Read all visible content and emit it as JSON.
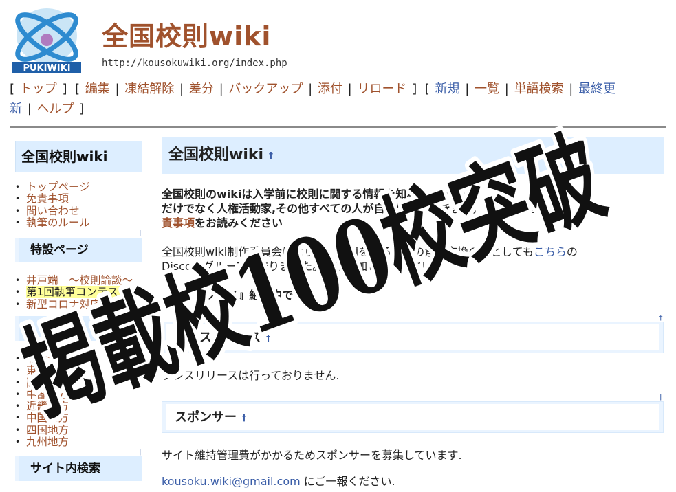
{
  "header": {
    "logo_text": "PUKIWIKI",
    "title": "全国校則wiki",
    "url": "http://kousokuwiki.org/index.php"
  },
  "nav": {
    "bracket_open": "[",
    "bracket_close": "]",
    "sep": "|",
    "top": "トップ",
    "edit": "編集",
    "unfreeze": "凍結解除",
    "diff": "差分",
    "backup": "バックアップ",
    "attach": "添付",
    "reload": "リロード",
    "new": "新規",
    "list": "一覧",
    "search": "単語検索",
    "recent_part1": "最終更",
    "recent_part2": "新",
    "help": "ヘルプ"
  },
  "sidebar": {
    "title": "全国校則wiki",
    "items": [
      "トップページ",
      "免責事項",
      "問い合わせ",
      "執筆のルール"
    ],
    "special_title": "特設ページ",
    "special_items": [
      "井戸端　～校則論談～",
      "第1回執筆コンテスト",
      "新型コロナ対応"
    ],
    "region_items": [
      "北海道",
      "東北地方",
      "関東地方",
      "中部地方",
      "近畿地方",
      "中国地方",
      "四国地方",
      "九州地方"
    ],
    "search_title": "サイト内検索",
    "dagger": "†"
  },
  "main": {
    "h2": "全国校則wiki",
    "dagger": "†",
    "intro_line1": "全国校則のwikiは入学前に校則に関する情報を知れるよう、学生",
    "intro_line2": "だけでなく人権活動家,その他すべての人が自由に編集できます。編集の際は",
    "intro_link": "免",
    "intro_link2": "責事項",
    "intro_end": "をお読みください",
    "discord_line1": "全国校則wiki制作委員会はより良いwikiを作るための意見交換の場としても",
    "discord_link": "こちら",
    "discord_end": "の",
    "discord_line2": "Discordグループを作りました。ぜひ参加してください。",
    "access_text": "『定期アクセス』絶賛中です",
    "press_title": "プレスリリース",
    "press_text": "プレスリリースは行っておりません.",
    "sponsor_title": "スポンサー",
    "sponsor_text": "サイト維持管理費がかかるためスポンサーを募集しています.",
    "email": "kousoku.wiki@gmail.com",
    "email_after": " にご一報ください."
  },
  "overlay": {
    "banner_text": "掲載校100校突破"
  }
}
